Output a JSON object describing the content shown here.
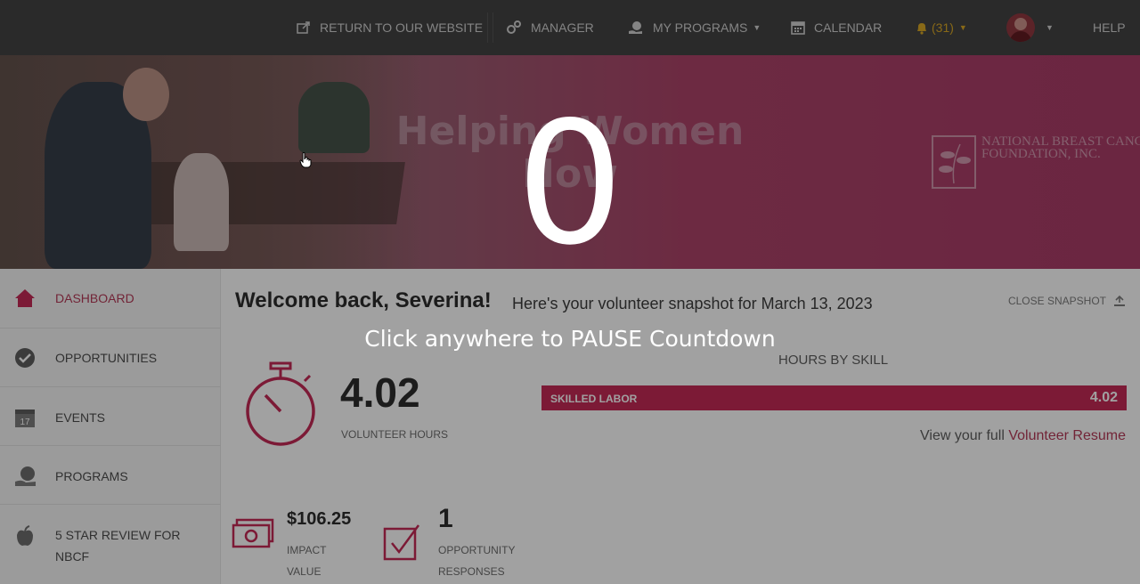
{
  "nav": {
    "return_label": "RETURN TO OUR WEBSITE",
    "manager_label": "MANAGER",
    "programs_label": "MY PROGRAMS",
    "calendar_label": "CALENDAR",
    "notifications_count": "(31)",
    "help_label": "HELP"
  },
  "hero": {
    "headline_line1": "Helping Women",
    "headline_line2": "Now",
    "logo_text": "NATIONAL BREAST CANCER FOUNDATION, INC."
  },
  "sidebar": {
    "items": [
      {
        "label": "DASHBOARD",
        "icon": "home-icon"
      },
      {
        "label": "OPPORTUNITIES",
        "icon": "check-circle-icon"
      },
      {
        "label": "EVENTS",
        "icon": "calendar-icon"
      },
      {
        "label": "PROGRAMS",
        "icon": "globe-hand-icon"
      },
      {
        "label": "5 STAR REVIEW FOR NBCF",
        "icon": "apple-icon"
      }
    ]
  },
  "main": {
    "welcome": "Welcome back, Severina!",
    "snapshot": "Here's your volunteer snapshot for March 13, 2023",
    "close_snapshot": "CLOSE SNAPSHOT",
    "hours_value": "4.02",
    "hours_label": "VOLUNTEER HOURS",
    "skills_title": "HOURS BY SKILL",
    "skill_name": "SKILLED LABOR",
    "skill_value": "4.02",
    "resume_prefix": "View your full",
    "resume_link": "Volunteer Resume",
    "impact_value": "$106.25",
    "impact_label": "IMPACT VALUE",
    "responses_value": "1",
    "responses_label": "OPPORTUNITY RESPONSES"
  },
  "overlay": {
    "countdown": "0",
    "message": "Click anywhere to PAUSE Countdown"
  },
  "colors": {
    "accent": "#b1304f",
    "skill_bar": "#c21f4e",
    "nav_bg": "#3a3a3a",
    "bell": "#d6a21a"
  }
}
